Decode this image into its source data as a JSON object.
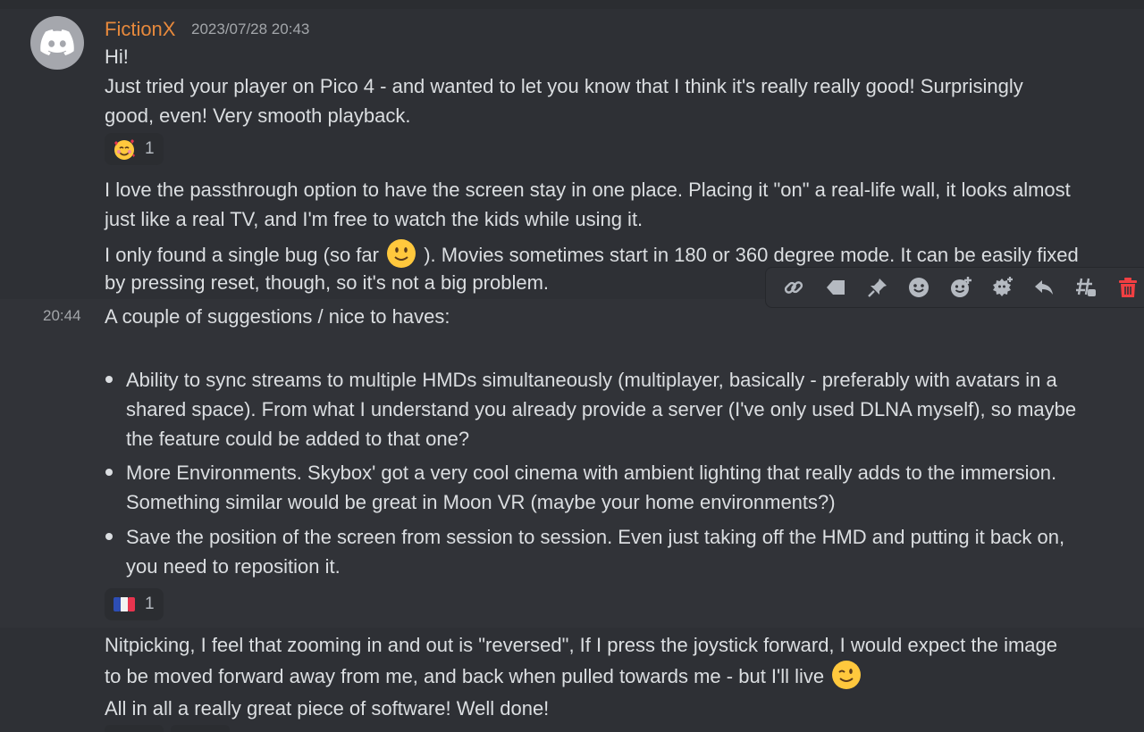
{
  "message": {
    "username": "FictionX",
    "timestamp": "2023/07/28 20:43",
    "side_timestamp": "20:44",
    "lines": {
      "l1": "Hi!",
      "l2": "Just tried your player on Pico 4 - and wanted to let you know that I think it's really really good!  Surprisingly",
      "l3": "good, even! Very smooth playback.",
      "l4": "I love the passthrough option to have the screen stay in one place. Placing it \"on\" a real-life wall, it looks almost",
      "l5": "just like a real TV, and I'm free to watch the kids while using it.",
      "l6a": "I only found a single bug (so far",
      "l6b": "). Movies sometimes start in 180 or 360 degree mode. It can be easily fixed",
      "l7": "by pressing reset, though, so it's not a big problem.",
      "l8": "A couple of suggestions / nice to haves:",
      "b1_1": "Ability to sync streams to multiple HMDs simultaneously (multiplayer, basically - preferably with avatars in a",
      "b1_2": "shared space). From what I understand you already provide a server (I've only used DLNA myself), so maybe",
      "b1_3": "the feature could be added to that one?",
      "b2_1": "More Environments. Skybox' got a very cool cinema with ambient lighting that really adds to the immersion.",
      "b2_2": "Something similar would be great in Moon VR (maybe your home environments?)",
      "b3_1": "Save the position of the screen from session to session. Even just taking off the HMD and putting it back on,",
      "b3_2": "you need to reposition it.",
      "l9": "Nitpicking, I feel that zooming in and out is \"reversed\", If I press the joystick forward, I would expect the image",
      "l10": "to be moved forward away from me, and back when pulled towards me - but I'll live",
      "l11": "All in all a really great piece of software!  Well done!"
    },
    "reactions": [
      {
        "emoji": "smiling-face-with-hearts-emoji",
        "count": "1"
      },
      {
        "emoji": "flag-france-emoji",
        "count": "1"
      }
    ]
  },
  "toolbar": {
    "buttons": [
      "link-icon",
      "tag-icon",
      "pin-icon",
      "emoji-icon",
      "add-reaction-icon",
      "super-reaction-icon",
      "reply-icon",
      "thread-icon",
      "delete-icon"
    ]
  },
  "colors": {
    "background": "#313338",
    "hover_background": "#2e3035",
    "username": "#e7893c",
    "text": "#dbdee1",
    "muted": "#a3a6aa",
    "delete": "#f23f42"
  }
}
